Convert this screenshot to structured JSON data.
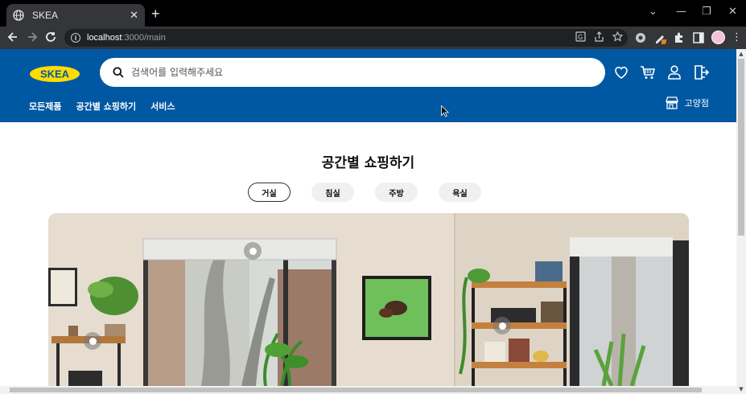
{
  "browser": {
    "tab_title": "SKEA",
    "tab_close": "✕",
    "new_tab": "+",
    "url_host": "localhost",
    "url_path": ":3000/main",
    "win_min": "—",
    "win_restore": "❐",
    "win_close": "✕",
    "win_chevron": "⌄"
  },
  "header": {
    "logo_text": "SKEA",
    "search_placeholder": "검색어를 입력해주세요",
    "nav": [
      "모든제품",
      "공간별 쇼핑하기",
      "서비스"
    ],
    "store_name": "고양점"
  },
  "main": {
    "title": "공간별 쇼핑하기",
    "rooms": [
      "거실",
      "침실",
      "주방",
      "욕실"
    ],
    "active_room": "거실"
  },
  "colors": {
    "brand_blue": "#0058a3",
    "brand_yellow": "#ffdb00"
  }
}
